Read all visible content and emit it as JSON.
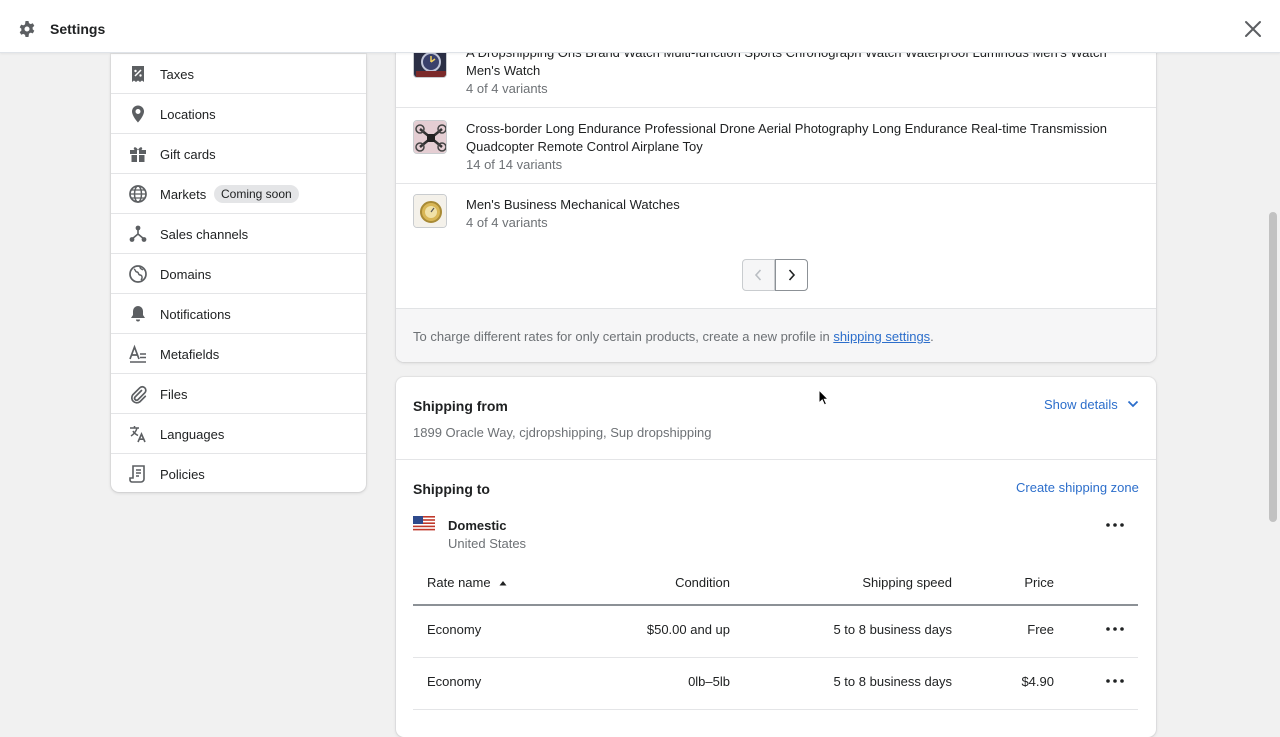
{
  "window": {
    "title": "Settings"
  },
  "sidebar": {
    "items": [
      {
        "label": "Taxes",
        "icon": "taxes-icon"
      },
      {
        "label": "Locations",
        "icon": "location-pin-icon"
      },
      {
        "label": "Gift cards",
        "icon": "gift-icon"
      },
      {
        "label": "Markets",
        "icon": "globe-icon",
        "badge": "Coming soon"
      },
      {
        "label": "Sales channels",
        "icon": "sales-channels-icon"
      },
      {
        "label": "Domains",
        "icon": "domains-globe-icon"
      },
      {
        "label": "Notifications",
        "icon": "bell-icon"
      },
      {
        "label": "Metafields",
        "icon": "metafields-icon"
      },
      {
        "label": "Files",
        "icon": "paperclip-icon"
      },
      {
        "label": "Languages",
        "icon": "translate-icon"
      },
      {
        "label": "Policies",
        "icon": "policies-icon"
      }
    ]
  },
  "products": [
    {
      "title": "A Dropshipping Oris Brand Watch Multi-function Sports Chronograph Watch Waterproof Luminous Men's Watch Men's Watch",
      "variants": "4 of 4 variants"
    },
    {
      "title": "Cross-border Long Endurance Professional Drone Aerial Photography Long Endurance Real-time Transmission Quadcopter Remote Control Airplane Toy",
      "variants": "14 of 14 variants"
    },
    {
      "title": "Men's Business Mechanical Watches",
      "variants": "4 of 4 variants"
    }
  ],
  "note": {
    "text": "To charge different rates for only certain products, create a new profile in ",
    "link": "shipping settings",
    "end": "."
  },
  "shipping_from": {
    "title": "Shipping from",
    "address": "1899 Oracle Way, cjdropshipping, Sup dropshipping",
    "show_details": "Show details"
  },
  "shipping_to": {
    "title": "Shipping to",
    "create_zone": "Create shipping zone",
    "zone": {
      "name": "Domestic",
      "country": "United States"
    },
    "columns": {
      "rate_name": "Rate name",
      "condition": "Condition",
      "speed": "Shipping speed",
      "price": "Price"
    },
    "rates": [
      {
        "name": "Economy",
        "condition": "$50.00 and up",
        "speed": "5 to 8 business days",
        "price": "Free"
      },
      {
        "name": "Economy",
        "condition": "0lb–5lb",
        "speed": "5 to 8 business days",
        "price": "$4.90"
      }
    ]
  },
  "colors": {
    "link": "#2c6ecb",
    "background": "#f1f1f1",
    "text": "#202223",
    "muted": "#6d7175"
  }
}
